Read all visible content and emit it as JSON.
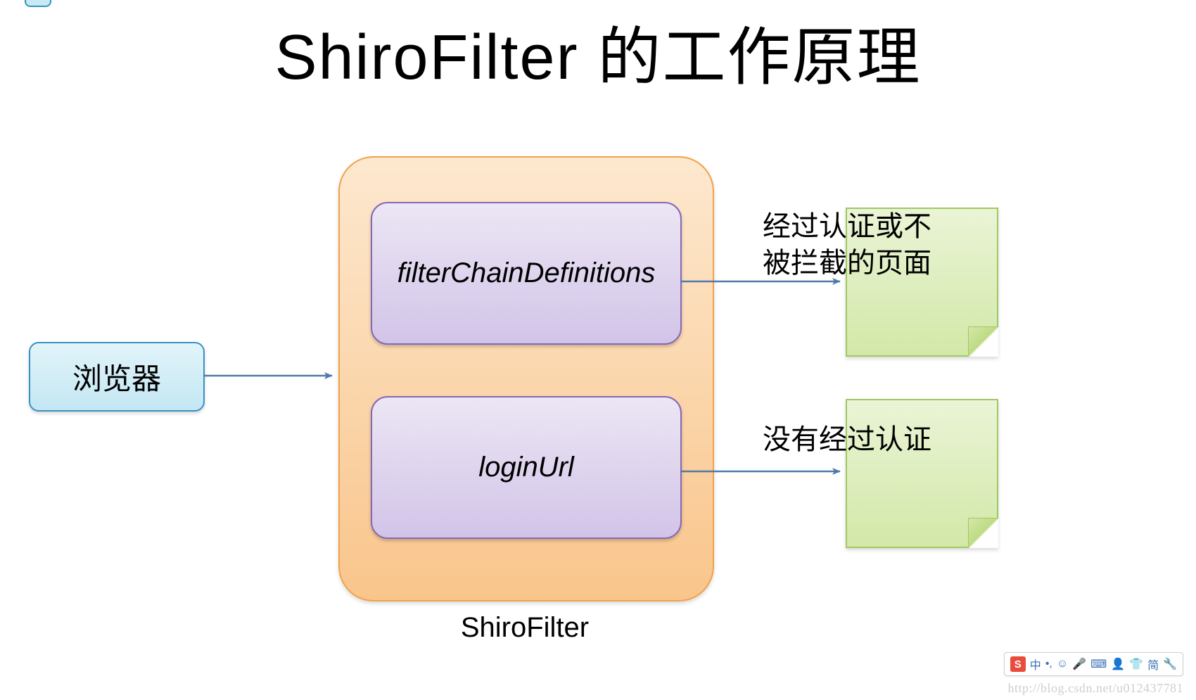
{
  "title": "ShiroFilter 的工作原理",
  "nodes": {
    "browser": "浏览器",
    "container_label": "ShiroFilter",
    "filterChainDefinitions": "filterChainDefinitions",
    "loginUrl": "loginUrl"
  },
  "edges": {
    "authenticated": "经过认证或不\n被拦截的页面",
    "not_authenticated": "没有经过认证"
  },
  "watermark": "http://blog.csdn.net/u012437781",
  "ime": {
    "logo": "S",
    "items": [
      "中",
      "•,",
      "☺",
      "🎤",
      "⌨",
      "👤",
      "👕",
      "简",
      "🔧"
    ]
  },
  "colors": {
    "arrow": "#5079a8",
    "browserBorder": "#3891c3",
    "containerBorder": "#f0a24a",
    "purpleBorder": "#8568b5",
    "stickyBorder": "#a0c864"
  }
}
